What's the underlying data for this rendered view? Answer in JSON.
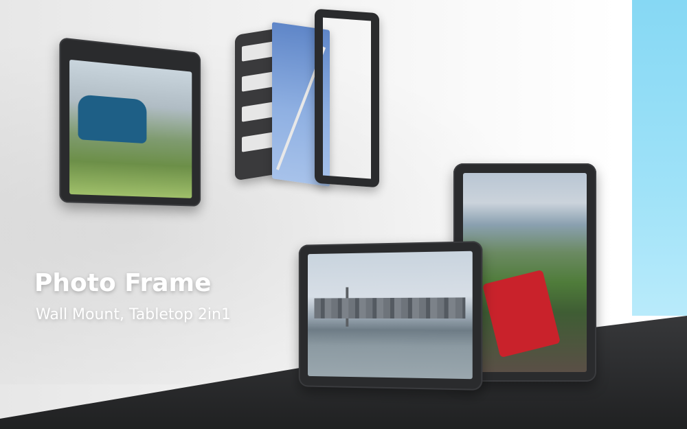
{
  "headline": "Photo Frame",
  "subline": "Wall Mount, Tabletop 2in1",
  "colors": {
    "frame": "#2a2b2d",
    "table": "#2d2e30",
    "sky": "#86d8f4",
    "text": "#ffffff"
  }
}
